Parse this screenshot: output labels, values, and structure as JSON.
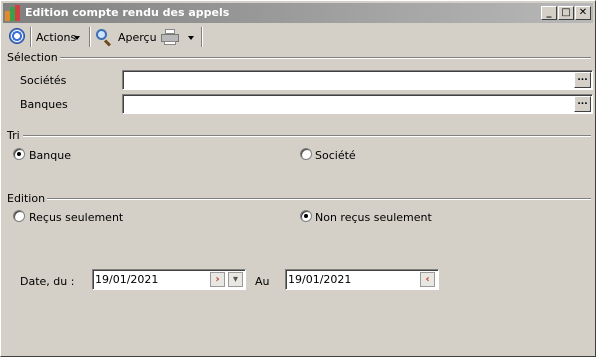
{
  "window": {
    "title": "Edition compte rendu des appels",
    "controls": {
      "minimize": "_",
      "maximize": "□",
      "close": "✕"
    }
  },
  "toolbar": {
    "actions_label": "Actions",
    "apercu_label": "Aperçu"
  },
  "selection": {
    "group_label": "Sélection",
    "societes_label": "Sociétés",
    "societes_value": "",
    "banques_label": "Banques",
    "banques_value": "",
    "ellipsis": "..."
  },
  "tri": {
    "group_label": "Tri",
    "options": [
      {
        "label": "Banque",
        "checked": true
      },
      {
        "label": "Société",
        "checked": false
      }
    ]
  },
  "edition": {
    "group_label": "Edition",
    "options": [
      {
        "label": "Reçus seulement",
        "checked": false
      },
      {
        "label": "Non reçus seulement",
        "checked": true
      }
    ]
  },
  "dates": {
    "from_label": "Date, du :",
    "from_value": "19/01/2021",
    "to_label": "Au",
    "to_value": "19/01/2021"
  },
  "colors": {
    "window_bg": "#d4d0c8",
    "titlebar": "#808080",
    "accent": "#3a6fd8"
  }
}
